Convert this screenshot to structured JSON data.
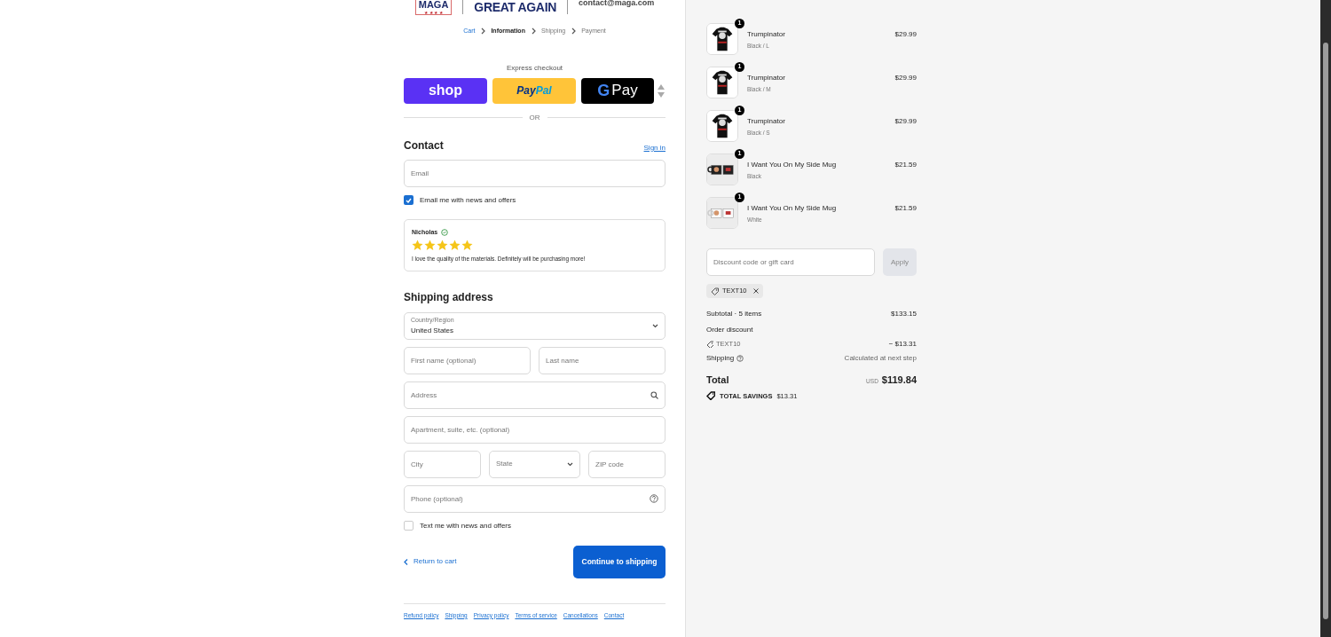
{
  "header": {
    "logo_word": "MAGA",
    "logo_stars": "★ ★ ★ ★",
    "tagline": "GREAT AGAIN",
    "email": "contact@maga.com"
  },
  "breadcrumbs": [
    {
      "label": "Cart",
      "completed": true,
      "selected": false
    },
    {
      "label": "Information",
      "completed": false,
      "selected": true
    },
    {
      "label": "Shipping",
      "completed": false,
      "selected": false
    },
    {
      "label": "Payment",
      "completed": false,
      "selected": false
    }
  ],
  "express_checkout": {
    "title": "Express checkout",
    "buttons": [
      {
        "kind": "shop",
        "label": "shop"
      },
      {
        "kind": "paypal",
        "label": "Pay",
        "label_2": "Pal"
      },
      {
        "kind": "gpay",
        "label": "G",
        "label_2": "Pay"
      }
    ],
    "divider": "OR"
  },
  "contact": {
    "heading": "Contact",
    "sign_in": "Sign in",
    "email_placeholder": "Email",
    "newsletter": {
      "label": "Email me with news and offers",
      "checked": true
    }
  },
  "review": {
    "name": "Nicholas",
    "stars": 5,
    "text": "I love the quality of the materials. Definitely will be purchasing more!"
  },
  "shipping_address": {
    "heading": "Shipping address",
    "rows": [
      [
        {
          "kind": "select",
          "label": "Country/Region",
          "value": "United States"
        }
      ],
      [
        {
          "kind": "text",
          "placeholder": "First name (optional)"
        },
        {
          "kind": "text",
          "placeholder": "Last name"
        }
      ],
      [
        {
          "kind": "search",
          "placeholder": "Address"
        }
      ],
      [
        {
          "kind": "text",
          "placeholder": "Apartment, suite, etc. (optional)"
        }
      ],
      [
        {
          "kind": "text",
          "placeholder": "City"
        },
        {
          "kind": "select",
          "placeholder": "State"
        },
        {
          "kind": "text",
          "placeholder": "ZIP code"
        }
      ],
      [
        {
          "kind": "help",
          "placeholder": "Phone (optional)"
        }
      ]
    ],
    "sms": {
      "label": "Text me with news and offers",
      "checked": false
    }
  },
  "actions": {
    "back": "Return to cart",
    "continue": "Continue to shipping"
  },
  "footer_links": [
    "Refund policy",
    "Shipping",
    "Privacy policy",
    "Terms of service",
    "Cancellations",
    "Contact"
  ],
  "order": {
    "items": [
      {
        "name": "Trumpinator",
        "variant": "Black / L",
        "price": "$29.99",
        "quantity": "1",
        "kind": "shirt"
      },
      {
        "name": "Trumpinator",
        "variant": "Black / M",
        "price": "$29.99",
        "quantity": "1",
        "kind": "shirt"
      },
      {
        "name": "Trumpinator",
        "variant": "Black / S",
        "price": "$29.99",
        "quantity": "1",
        "kind": "shirt"
      },
      {
        "name": "I Want You On My Side Mug",
        "variant": "Black",
        "price": "$21.59",
        "quantity": "1",
        "kind": "mug_black"
      },
      {
        "name": "I Want You On My Side Mug",
        "variant": "White",
        "price": "$21.59",
        "quantity": "1",
        "kind": "mug_white"
      }
    ],
    "discount_placeholder": "Discount code or gift card",
    "apply": "Apply",
    "applied_code": "TEXT10",
    "subtotal_label": "Subtotal · 5 items",
    "subtotal": "$133.15",
    "discount_label": "Order discount",
    "discount_code": "TEXT10",
    "discount_amount": "− $13.31",
    "shipping_label": "Shipping",
    "shipping_value": "Calculated at next step",
    "total_label": "Total",
    "currency": "USD",
    "total": "$119.84",
    "savings_label": "TOTAL SAVINGS",
    "savings": "$13.31"
  }
}
